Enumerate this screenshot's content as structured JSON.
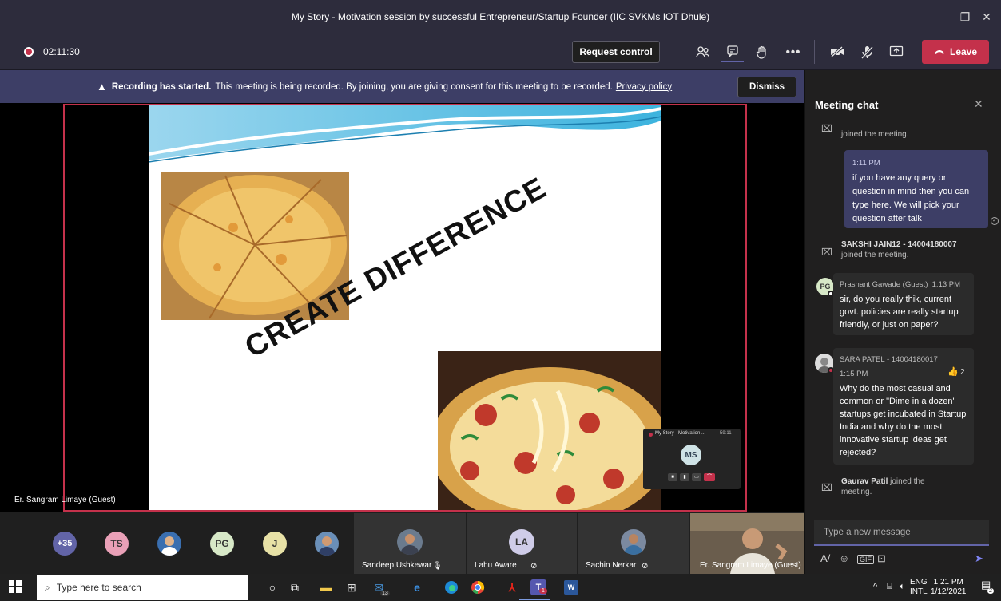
{
  "window": {
    "title": "My Story - Motivation session by successful Entrepreneur/Startup Founder (IIC SVKMs IOT Dhule)",
    "minimize": "—",
    "maximize": "❐",
    "close": "✕"
  },
  "toolbar": {
    "timer": "02:11:30",
    "request_control": "Request control",
    "leave": "Leave",
    "colors": {
      "leave": "#c4314b",
      "accent": "#6264a7"
    }
  },
  "banner": {
    "bold": "Recording has started.",
    "text": "This meeting is being recorded. By joining, you are giving consent for this meeting to be recorded.",
    "link": "Privacy policy",
    "dismiss": "Dismiss"
  },
  "slide": {
    "headline": "CREATE DIFFERENCE"
  },
  "presenter_label": "Er. Sangram Limaye (Guest)",
  "mini_window": {
    "title": "My Story - Motivation ...",
    "time": "59:11",
    "initials": "MS"
  },
  "participants": {
    "overflow": "+35",
    "avatars": [
      {
        "initials": "TS",
        "color": "#e9a0b7"
      },
      {
        "initials": "",
        "color": "#3a6fb0"
      },
      {
        "initials": "PG",
        "color": "#d7e8c7"
      },
      {
        "initials": "J",
        "color": "#e7e1a6"
      },
      {
        "initials": "",
        "color": "#6a8fb8"
      }
    ],
    "tiles": [
      {
        "name": "Sandeep Ushkewar"
      },
      {
        "name": "Lahu Aware",
        "initials": "LA"
      },
      {
        "name": "Sachin Nerkar"
      },
      {
        "name": "Er. Sangram Limaye (Guest)"
      }
    ]
  },
  "chat": {
    "title": "Meeting chat",
    "top_sys": "joined the meeting.",
    "mine": {
      "time": "1:11 PM",
      "text": "if you have any query or question in mind then you can type here. We will pick your question after talk"
    },
    "sys1": {
      "name": "SAKSHI JAIN12 - 14004180007",
      "text": "joined the meeting."
    },
    "msg1": {
      "initials": "PG",
      "name": "Prashant Gawade (Guest)",
      "time": "1:13 PM",
      "text": "sir, do you really thik, current govt. policies are really startup friendly, or just on paper?"
    },
    "msg2": {
      "name": "SARA PATEL - 14004180017",
      "time": "1:15 PM",
      "likes": "2",
      "text": "Why do the most casual and common or \"Dime in a dozen\" startups get incubated in Startup India and why do the most innovative startup ideas get rejected?"
    },
    "sys2": {
      "name": "Gaurav Patil",
      "text": "joined the meeting."
    },
    "input_placeholder": "Type a new message"
  },
  "taskbar": {
    "search_placeholder": "Type here to search",
    "lang1": "ENG",
    "lang2": "INTL",
    "time": "1:21 PM",
    "date": "1/12/2021",
    "mail_badge": "13",
    "teams_badge": "1",
    "notif": "2"
  }
}
